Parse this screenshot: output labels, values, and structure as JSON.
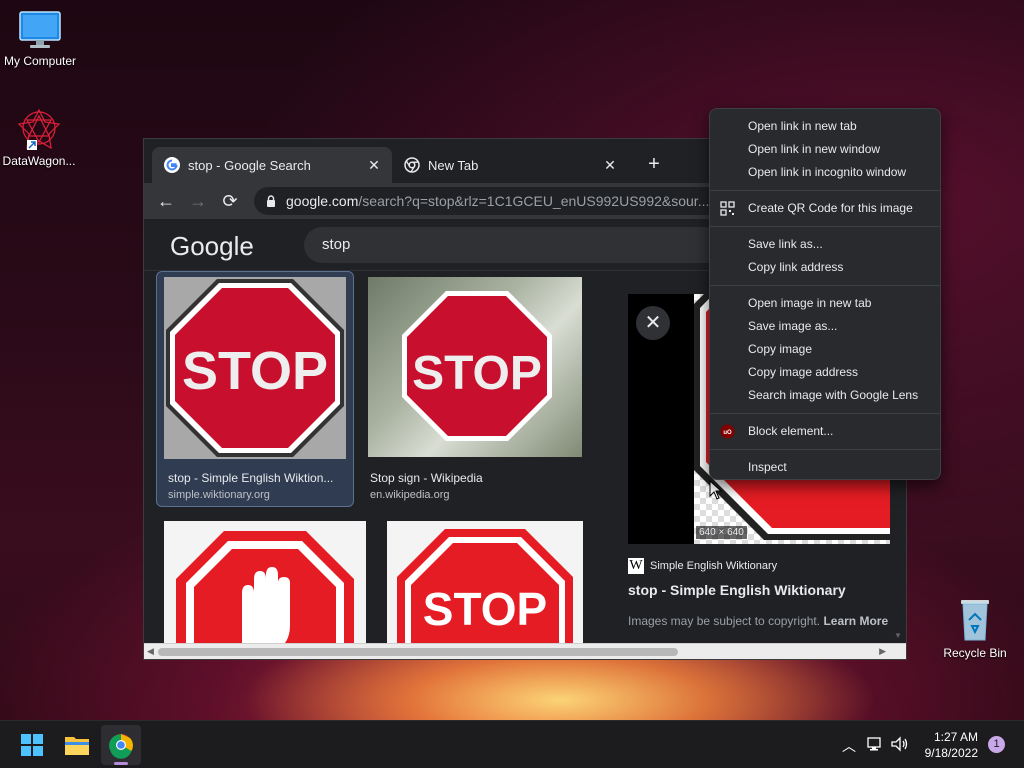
{
  "desktop": {
    "icons": [
      {
        "label": "My Computer"
      },
      {
        "label": "DataWagon..."
      },
      {
        "label": "Recycle Bin"
      }
    ]
  },
  "browser": {
    "tabs": [
      {
        "title": "stop - Google Search",
        "active": true
      },
      {
        "title": "New Tab",
        "active": false
      }
    ],
    "omnibox": {
      "host": "google.com",
      "path": "/search?q=stop&rlz=1C1GCEU_enUS992US992&sour..."
    },
    "google": {
      "logo": "Google",
      "query": "stop"
    },
    "results": [
      {
        "title": "stop - Simple English Wiktion...",
        "site": "simple.wiktionary.org",
        "sign_text": "STOP"
      },
      {
        "title": "Stop sign - Wikipedia",
        "site": "en.wikipedia.org",
        "sign_text": "STOP"
      },
      {
        "sign_text": ""
      },
      {
        "sign_text": "STOP"
      }
    ],
    "preview": {
      "dimensions": "640 × 640",
      "source": "Simple English Wiktionary",
      "title": "stop - Simple English Wiktionary",
      "copyright": "Images may be subject to copyright.",
      "learn_more": "Learn More"
    }
  },
  "context_menu": {
    "groups": [
      [
        "Open link in new tab",
        "Open link in new window",
        "Open link in incognito window"
      ],
      [
        "Create QR Code for this image"
      ],
      [
        "Save link as...",
        "Copy link address"
      ],
      [
        "Open image in new tab",
        "Save image as...",
        "Copy image",
        "Copy image address",
        "Search image with Google Lens"
      ],
      [
        "Block element..."
      ],
      [
        "Inspect"
      ]
    ]
  },
  "taskbar": {
    "time": "1:27 AM",
    "date": "9/18/2022",
    "notification_count": "1"
  },
  "colors": {
    "stop_red": "#c8102e",
    "chrome_dark": "#202124",
    "accent": "#8ab4f8"
  }
}
